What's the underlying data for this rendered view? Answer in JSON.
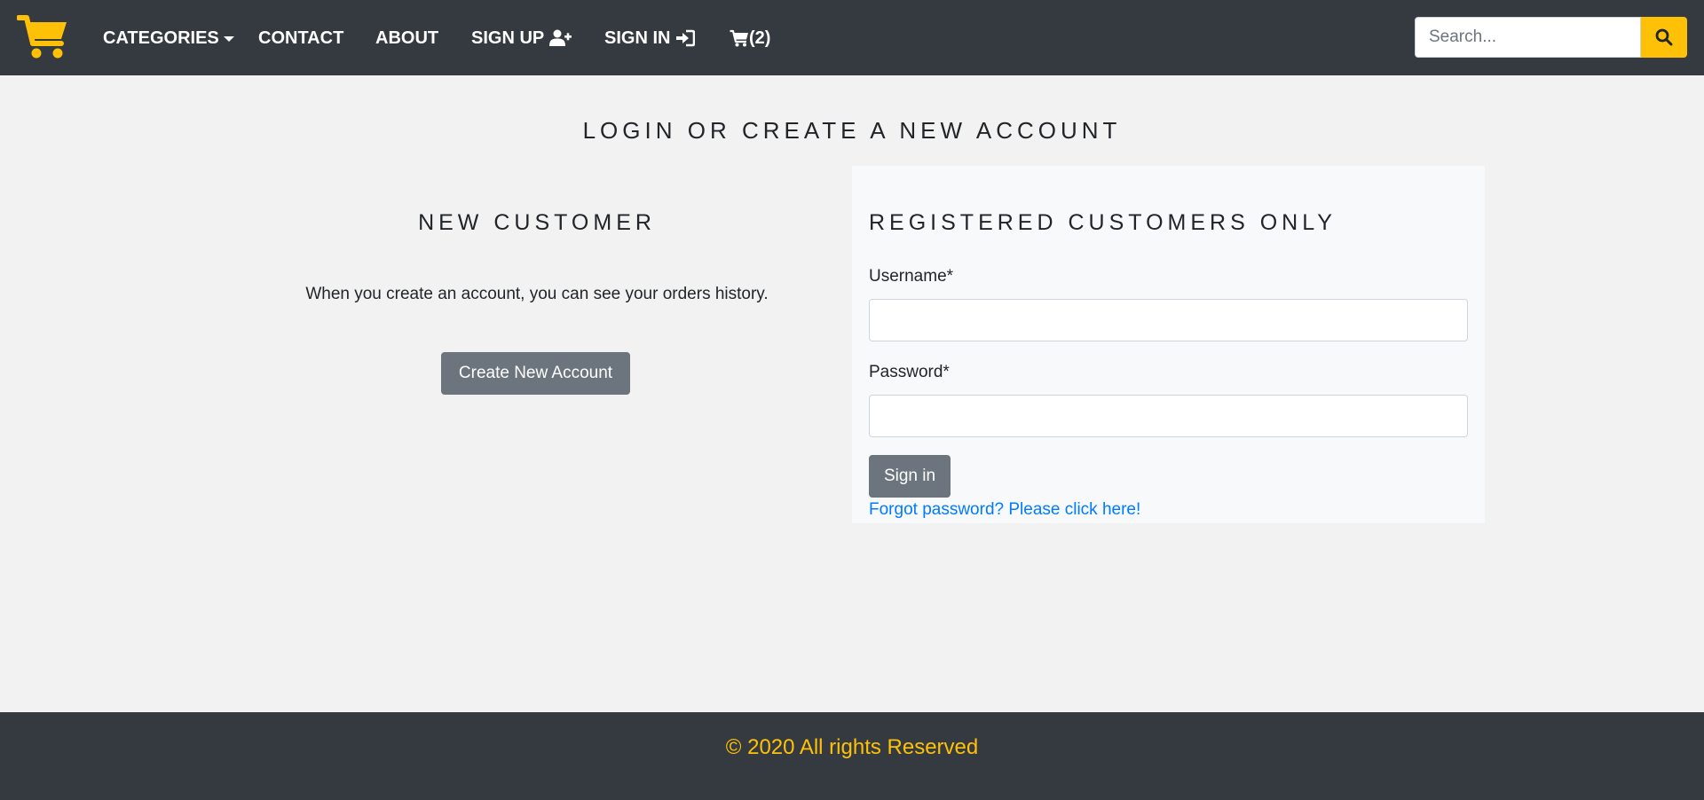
{
  "nav": {
    "logo_icon": "shopping-cart-icon",
    "categories": "CATEGORIES",
    "contact": "CONTACT",
    "about": "ABOUT",
    "sign_up": "SIGN UP",
    "sign_up_icon": "user-plus-icon",
    "sign_in": "SIGN IN",
    "sign_in_icon": "sign-in-icon",
    "cart_icon": "cart-icon",
    "cart_count": "(2)",
    "search_placeholder": "Search...",
    "search_icon": "search-icon"
  },
  "main": {
    "title": "LOGIN OR CREATE A NEW ACCOUNT",
    "new_customer": {
      "heading": "NEW CUSTOMER",
      "text": "When you create an account, you can see your orders history.",
      "button": "Create New Account"
    },
    "registered": {
      "heading": "REGISTERED CUSTOMERS ONLY",
      "username_label": "Username*",
      "username_value": "",
      "password_label": "Password*",
      "password_value": "",
      "signin_button": "Sign in",
      "forgot_link": "Forgot password? Please click here!"
    }
  },
  "footer": {
    "copyright": "© 2020 All rights Reserved"
  },
  "colors": {
    "navbar_bg": "#343a40",
    "accent": "#ffc107",
    "button_secondary": "#6c757d",
    "link": "#007bff",
    "page_bg": "#f2f2f2",
    "panel_bg": "#f8f9fa"
  }
}
